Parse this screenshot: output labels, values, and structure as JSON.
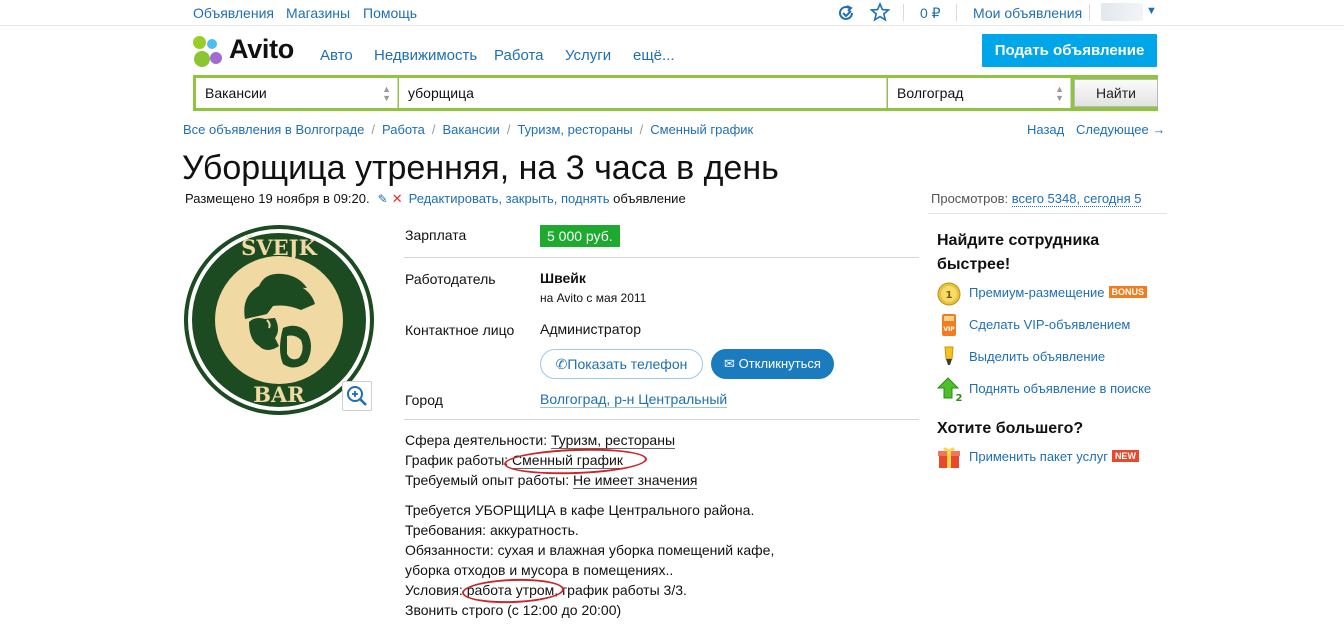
{
  "topbar": {
    "links": [
      "Объявления",
      "Магазины",
      "Помощь"
    ],
    "balance": "0 ₽",
    "my_ads": "Мои объявления"
  },
  "header": {
    "logo_text": "Avito",
    "categories": [
      "Авто",
      "Недвижимость",
      "Работа",
      "Услуги",
      "ещё..."
    ],
    "post_button": "Подать объявление"
  },
  "search": {
    "category": "Вакансии",
    "query": "уборщица",
    "location": "Волгоград",
    "submit": "Найти"
  },
  "breadcrumb": {
    "items": [
      "Все объявления в Волгограде",
      "Работа",
      "Вакансии",
      "Туризм, рестораны",
      "Сменный график"
    ],
    "separator": "/",
    "back": "Назад",
    "next": "Следующее →"
  },
  "ad": {
    "title": "Уборщица утренняя, на 3 часа в день",
    "posted": "Размещено 19 ноября в 09:20.",
    "edit_links": "Редактировать, закрыть, поднять",
    "edit_suffix": "объявление",
    "views_label": "Просмотров:",
    "views_value": "всего 5348, сегодня 5",
    "logo_top": "ŠVEJK",
    "logo_bottom": "BAR",
    "params": {
      "salary_label": "Зарплата",
      "salary_value": "5 000 руб.",
      "employer_label": "Работодатель",
      "employer_name": "Швейк",
      "employer_since": "на Avito с мая 2011",
      "contact_label": "Контактное лицо",
      "contact_name": "Администратор",
      "show_phone": "Показать телефон",
      "reply": "Откликнуться",
      "city_label": "Город",
      "city_value": "Волгоград, р-н Центральный"
    },
    "attributes": [
      {
        "label": "Сфера деятельности:",
        "value": "Туризм, рестораны"
      },
      {
        "label": "График работы:",
        "value": "Сменный график"
      },
      {
        "label": "Требуемый опыт работы:",
        "value": "Не имеет значения"
      }
    ],
    "description": [
      "Требуется УБОРЩИЦА в кафе Центрального района.",
      "Требования: аккуратность.",
      "Обязанности: сухая и влажная уборка помещений кафе,",
      "уборка отходов и мусора в помещениях..",
      "Условия: работа утром, график работы 3/3.",
      "Звонить строго (с 12:00 до 20:00)"
    ],
    "highlight_color": "#c8282c"
  },
  "sidebar": {
    "promo_title_1": "Найдите сотрудника",
    "promo_title_2": "быстрее!",
    "promo_items": [
      {
        "label": "Премиум-размещение",
        "badge": "BONUS",
        "icon": "premium-coin-icon"
      },
      {
        "label": "Сделать VIP-объявлением",
        "badge": "",
        "icon": "vip-icon"
      },
      {
        "label": "Выделить объявление",
        "badge": "",
        "icon": "highlighter-icon"
      },
      {
        "label": "Поднять объявление в поиске",
        "badge": "",
        "icon": "raise-arrow-icon"
      }
    ],
    "more_title": "Хотите большего?",
    "package_item": {
      "label": "Применить пакет услуг",
      "badge": "NEW",
      "icon": "package-icon"
    }
  },
  "colors": {
    "link": "#1e6fb4",
    "search_border": "#8fc43f",
    "post_button": "#00a6e8",
    "salary": "#1eaa2f",
    "reply_button": "#1b7bbf"
  }
}
